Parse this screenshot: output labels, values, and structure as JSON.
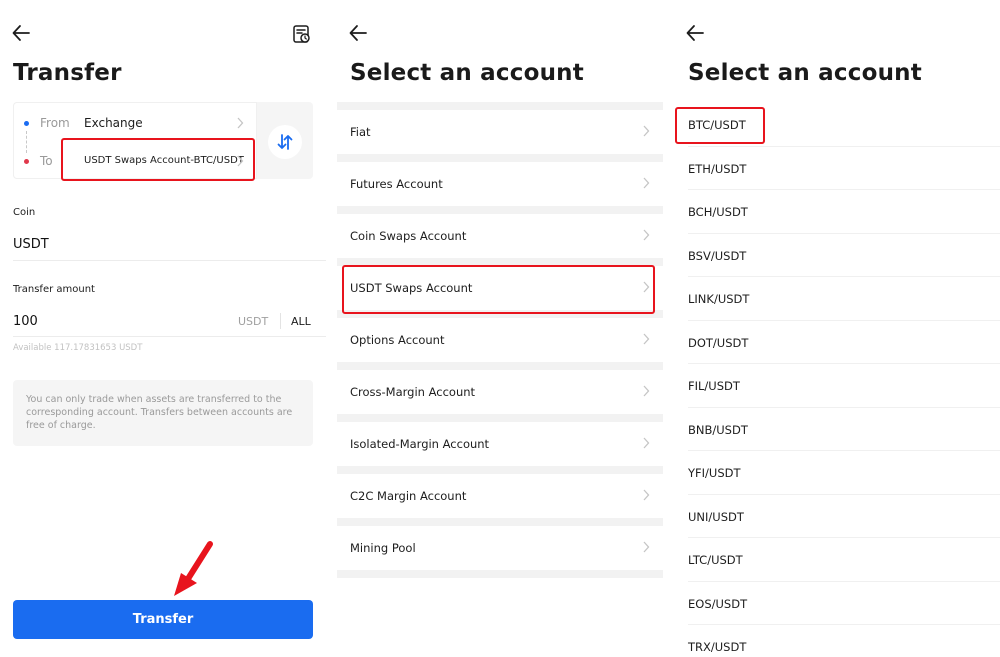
{
  "transfer": {
    "title": "Transfer",
    "from_label": "From",
    "from_value": "Exchange",
    "to_label": "To",
    "to_value": "USDT Swaps Account-BTC/USDT",
    "coin_label": "Coin",
    "coin_value": "USDT",
    "amount_label": "Transfer amount",
    "amount_value": "100",
    "amount_unit": "USDT",
    "all_label": "ALL",
    "available_text": "Available 117.17831653 USDT",
    "notice": "You can only trade when assets are transferred to the corresponding account. Transfers between accounts are free of charge.",
    "button_label": "Transfer"
  },
  "select_account": {
    "title": "Select an account",
    "accounts": [
      "Fiat",
      "Futures Account",
      "Coin Swaps Account",
      "USDT Swaps Account",
      "Options Account",
      "Cross-Margin Account",
      "Isolated-Margin Account",
      "C2C Margin Account",
      "Mining Pool"
    ]
  },
  "select_pair": {
    "title": "Select an account",
    "pairs": [
      "BTC/USDT",
      "ETH/USDT",
      "BCH/USDT",
      "BSV/USDT",
      "LINK/USDT",
      "DOT/USDT",
      "FIL/USDT",
      "BNB/USDT",
      "YFI/USDT",
      "UNI/USDT",
      "LTC/USDT",
      "EOS/USDT",
      "TRX/USDT"
    ]
  },
  "colors": {
    "accent": "#1a6cf0",
    "highlight": "#e8141d",
    "from_dot": "#1b6cf2",
    "to_dot": "#e0384b"
  }
}
